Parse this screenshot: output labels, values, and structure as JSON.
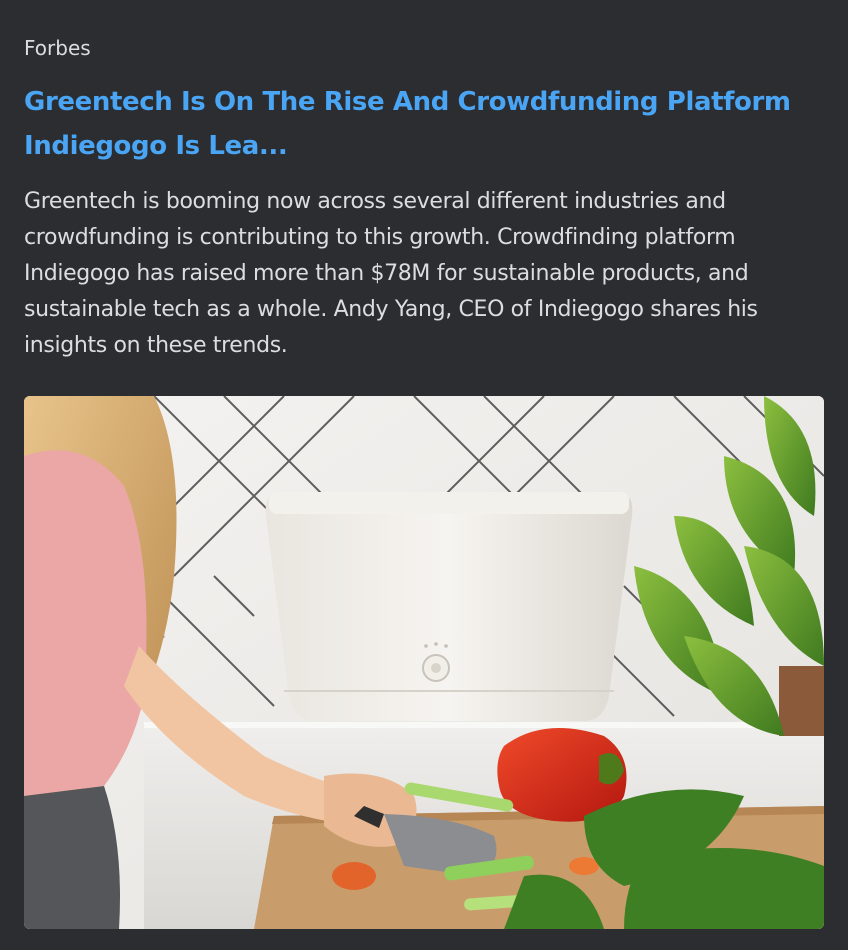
{
  "embed": {
    "provider": "Forbes",
    "title": "Greentech Is On The Rise And Crowdfunding Platform Indiegogo Is Lea...",
    "description": "Greentech is booming now across several different industries and crowdfunding is contributing to this growth. Crowdfinding platform Indiegogo has raised more than $78M for sustainable products, and sustainable tech as a whole. Andy Yang, CEO of Indiegogo shares his insights on these trends.",
    "image_alt": "Woman chopping vegetables next to a white countertop kitchen appliance and potted plant"
  },
  "colors": {
    "background": "#2b2d31",
    "link": "#4aa5f5",
    "text": "#dbdee1"
  }
}
